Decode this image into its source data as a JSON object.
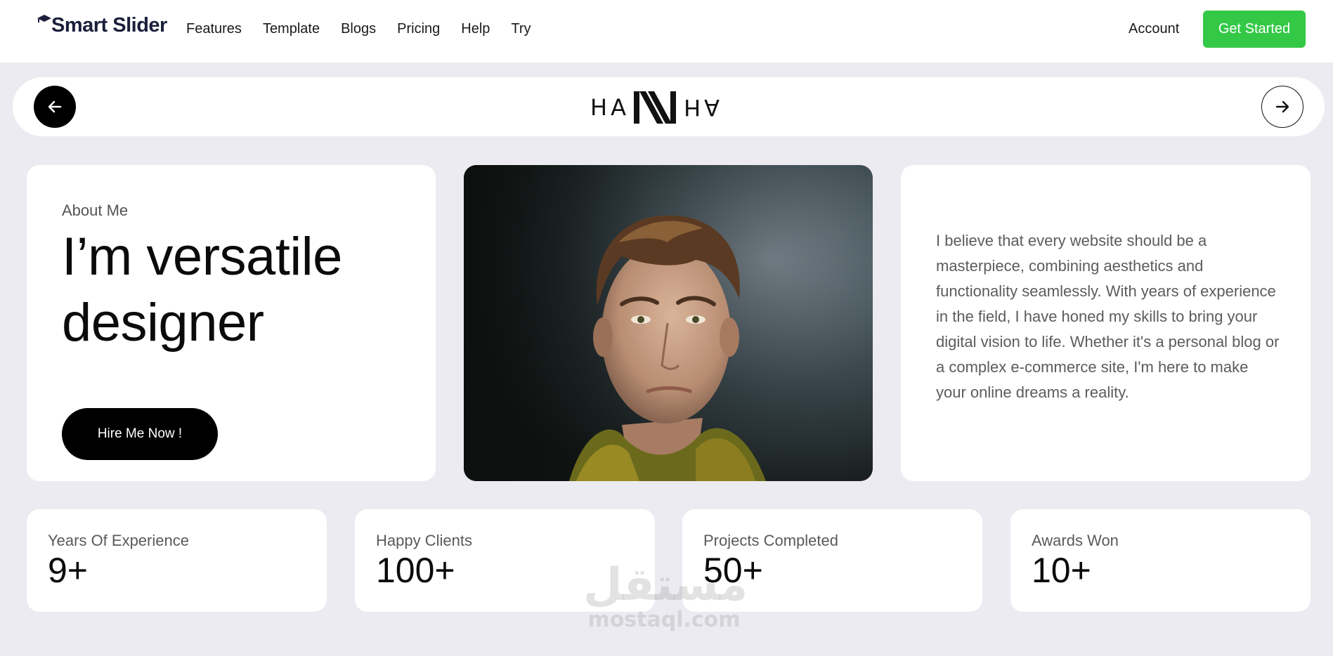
{
  "navbar": {
    "brand": "Smart Slider",
    "brand_icon": "graduation-cap-icon",
    "links": [
      "Features",
      "Template",
      "Blogs",
      "Pricing",
      "Help",
      "Try"
    ],
    "account": "Account",
    "cta": "Get Started",
    "cta_color": "#34c847"
  },
  "slider": {
    "prev_icon": "arrow-left-icon",
    "next_icon": "arrow-right-icon",
    "logo_left": "HA",
    "logo_right": "AH"
  },
  "about": {
    "label": "About Me",
    "title": "I’m versatile designer",
    "button": "Hire Me Now !"
  },
  "bio": {
    "text": "I believe that every website should be a masterpiece, combining aesthetics and functionality seamlessly. With years of experience in the field, I have honed my skills to bring your digital vision to life. Whether it's a personal blog or a complex e-commerce site, I'm here to make your online dreams a reality."
  },
  "stats": [
    {
      "label": "Years Of Experience",
      "value": "9+"
    },
    {
      "label": "Happy Clients",
      "value": "100+"
    },
    {
      "label": "Projects Completed",
      "value": "50+"
    },
    {
      "label": "Awards Won",
      "value": "10+"
    }
  ],
  "watermark": {
    "arabic": "مستقل",
    "latin": "mostaql.com"
  }
}
